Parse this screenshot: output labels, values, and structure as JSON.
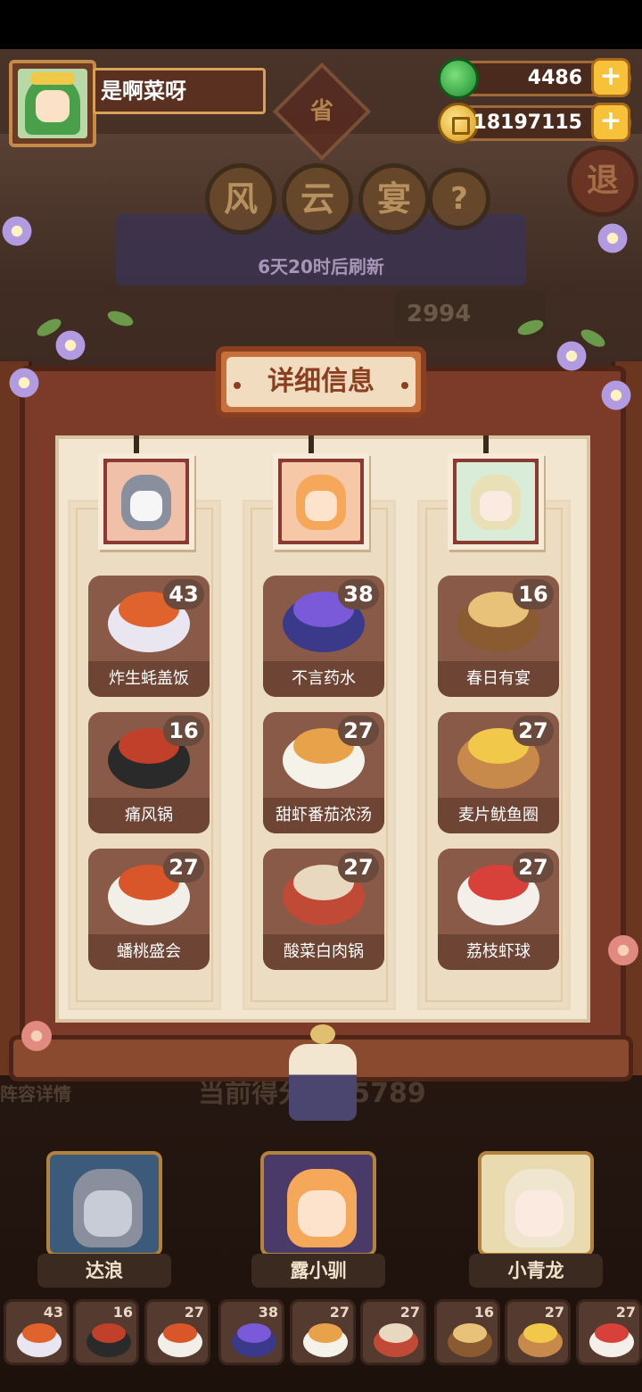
{
  "player": {
    "name": "是啊菜呀"
  },
  "currency": {
    "jade": {
      "value": "4486",
      "icon": "jade-icon"
    },
    "coin": {
      "value": "18197115",
      "icon": "coin-icon"
    },
    "plus": "+"
  },
  "event": {
    "badge": "省",
    "title_chars": [
      "风",
      "云",
      "宴"
    ],
    "help": "?",
    "exit": "退",
    "refresh": "6天20时后刷新",
    "score_partial": "2994",
    "current_score": "当前得分",
    "current_score_value": "155789",
    "lineup_label": "阵容详情"
  },
  "panel": {
    "title": "详细信息",
    "columns": [
      {
        "hero": "达浪",
        "dishes": [
          {
            "name": "炸生蚝盖饭",
            "count": "43",
            "plate": "#e9e6f2",
            "food": "#e0632e"
          },
          {
            "name": "痛风锅",
            "count": "16",
            "plate": "#2a2a2a",
            "food": "#c0402a"
          },
          {
            "name": "蟠桃盛会",
            "count": "27",
            "plate": "#f1efe8",
            "food": "#d8562a"
          }
        ]
      },
      {
        "hero": "露小驯",
        "dishes": [
          {
            "name": "不言药水",
            "count": "38",
            "plate": "#3b3a8a",
            "food": "#7a5ad8"
          },
          {
            "name": "甜虾番茄浓汤",
            "count": "27",
            "plate": "#f5f2ea",
            "food": "#e8a24a"
          },
          {
            "name": "酸菜白肉锅",
            "count": "27",
            "plate": "#c04a36",
            "food": "#e8d8c0"
          }
        ]
      },
      {
        "hero": "小青龙",
        "dishes": [
          {
            "name": "春日有宴",
            "count": "16",
            "plate": "#8a5a30",
            "food": "#e9c27a"
          },
          {
            "name": "麦片鱿鱼圈",
            "count": "27",
            "plate": "#c78a4a",
            "food": "#f1c84a"
          },
          {
            "name": "荔枝虾球",
            "count": "27",
            "plate": "#f5efea",
            "food": "#d8403a"
          }
        ]
      }
    ]
  },
  "team": [
    {
      "name": "达浪"
    },
    {
      "name": "露小驯"
    },
    {
      "name": "小青龙"
    }
  ],
  "dish_bar": [
    {
      "count": "43",
      "plate": "#e9e6f2",
      "food": "#e0632e"
    },
    {
      "count": "16",
      "plate": "#2a2a2a",
      "food": "#c0402a"
    },
    {
      "count": "27",
      "plate": "#f1efe8",
      "food": "#d8562a"
    },
    {
      "count": "38",
      "plate": "#3b3a8a",
      "food": "#7a5ad8"
    },
    {
      "count": "27",
      "plate": "#f5f2ea",
      "food": "#e8a24a"
    },
    {
      "count": "27",
      "plate": "#c04a36",
      "food": "#e8d8c0"
    },
    {
      "count": "16",
      "plate": "#8a5a30",
      "food": "#e9c27a"
    },
    {
      "count": "27",
      "plate": "#c78a4a",
      "food": "#f1c84a"
    },
    {
      "count": "27",
      "plate": "#f5efea",
      "food": "#d8403a"
    }
  ]
}
